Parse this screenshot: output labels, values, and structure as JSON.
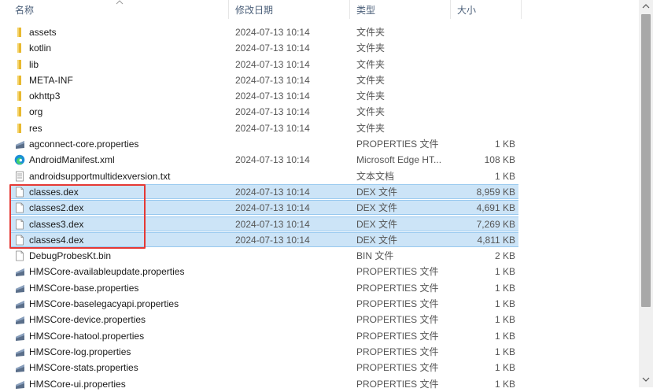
{
  "columns": {
    "name": "名称",
    "date": "修改日期",
    "type": "类型",
    "size": "大小"
  },
  "colors": {
    "selection": "#cce4f7",
    "highlight_box": "#e53935",
    "folder": "#e8b930"
  },
  "files": [
    {
      "name": "assets",
      "date": "2024-07-13 10:14",
      "type": "文件夹",
      "size": "",
      "icon": "folder-icon",
      "selected": false
    },
    {
      "name": "kotlin",
      "date": "2024-07-13 10:14",
      "type": "文件夹",
      "size": "",
      "icon": "folder-icon",
      "selected": false
    },
    {
      "name": "lib",
      "date": "2024-07-13 10:14",
      "type": "文件夹",
      "size": "",
      "icon": "folder-icon",
      "selected": false
    },
    {
      "name": "META-INF",
      "date": "2024-07-13 10:14",
      "type": "文件夹",
      "size": "",
      "icon": "folder-icon",
      "selected": false
    },
    {
      "name": "okhttp3",
      "date": "2024-07-13 10:14",
      "type": "文件夹",
      "size": "",
      "icon": "folder-icon",
      "selected": false
    },
    {
      "name": "org",
      "date": "2024-07-13 10:14",
      "type": "文件夹",
      "size": "",
      "icon": "folder-icon",
      "selected": false
    },
    {
      "name": "res",
      "date": "2024-07-13 10:14",
      "type": "文件夹",
      "size": "",
      "icon": "folder-icon",
      "selected": false
    },
    {
      "name": "agconnect-core.properties",
      "date": "",
      "type": "PROPERTIES 文件",
      "size": "1 KB",
      "icon": "properties-file-icon",
      "selected": false
    },
    {
      "name": "AndroidManifest.xml",
      "date": "2024-07-13 10:14",
      "type": "Microsoft Edge HT...",
      "size": "108 KB",
      "icon": "edge-icon",
      "selected": false
    },
    {
      "name": "androidsupportmultidexversion.txt",
      "date": "",
      "type": "文本文档",
      "size": "1 KB",
      "icon": "text-file-icon",
      "selected": false
    },
    {
      "name": "classes.dex",
      "date": "2024-07-13 10:14",
      "type": "DEX 文件",
      "size": "8,959 KB",
      "icon": "file-icon",
      "selected": true
    },
    {
      "name": "classes2.dex",
      "date": "2024-07-13 10:14",
      "type": "DEX 文件",
      "size": "4,691 KB",
      "icon": "file-icon",
      "selected": true
    },
    {
      "name": "classes3.dex",
      "date": "2024-07-13 10:14",
      "type": "DEX 文件",
      "size": "7,269 KB",
      "icon": "file-icon",
      "selected": true
    },
    {
      "name": "classes4.dex",
      "date": "2024-07-13 10:14",
      "type": "DEX 文件",
      "size": "4,811 KB",
      "icon": "file-icon",
      "selected": true
    },
    {
      "name": "DebugProbesKt.bin",
      "date": "",
      "type": "BIN 文件",
      "size": "2 KB",
      "icon": "file-icon",
      "selected": false
    },
    {
      "name": "HMSCore-availableupdate.properties",
      "date": "",
      "type": "PROPERTIES 文件",
      "size": "1 KB",
      "icon": "properties-file-icon",
      "selected": false
    },
    {
      "name": "HMSCore-base.properties",
      "date": "",
      "type": "PROPERTIES 文件",
      "size": "1 KB",
      "icon": "properties-file-icon",
      "selected": false
    },
    {
      "name": "HMSCore-baselegacyapi.properties",
      "date": "",
      "type": "PROPERTIES 文件",
      "size": "1 KB",
      "icon": "properties-file-icon",
      "selected": false
    },
    {
      "name": "HMSCore-device.properties",
      "date": "",
      "type": "PROPERTIES 文件",
      "size": "1 KB",
      "icon": "properties-file-icon",
      "selected": false
    },
    {
      "name": "HMSCore-hatool.properties",
      "date": "",
      "type": "PROPERTIES 文件",
      "size": "1 KB",
      "icon": "properties-file-icon",
      "selected": false
    },
    {
      "name": "HMSCore-log.properties",
      "date": "",
      "type": "PROPERTIES 文件",
      "size": "1 KB",
      "icon": "properties-file-icon",
      "selected": false
    },
    {
      "name": "HMSCore-stats.properties",
      "date": "",
      "type": "PROPERTIES 文件",
      "size": "1 KB",
      "icon": "properties-file-icon",
      "selected": false
    },
    {
      "name": "HMSCore-ui.properties",
      "date": "",
      "type": "PROPERTIES 文件",
      "size": "1 KB",
      "icon": "properties-file-icon",
      "selected": false
    }
  ]
}
